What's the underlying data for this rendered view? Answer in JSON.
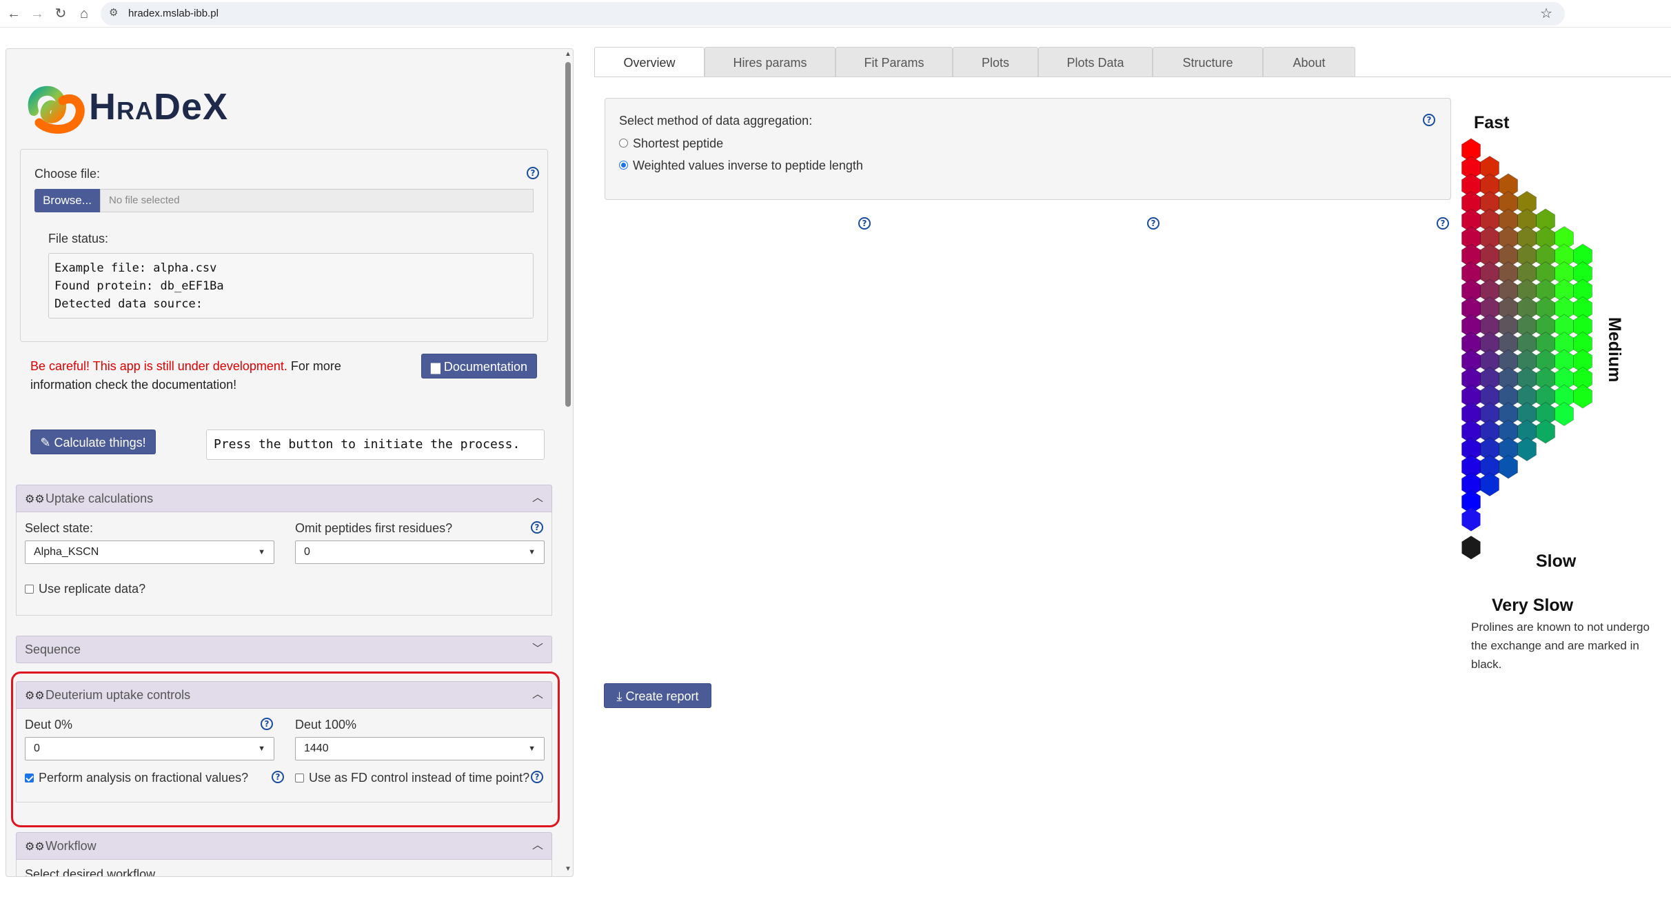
{
  "browser": {
    "url": "hradex.mslab-ibb.pl"
  },
  "logo": {
    "text": "HRaDeX"
  },
  "file": {
    "choose_label": "Choose file:",
    "browse_label": "Browse...",
    "placeholder": "No file selected",
    "status_label": "File status:",
    "status_lines": [
      "Example file: alpha.csv",
      "Found protein: db_eEF1Ba",
      "Detected data source:"
    ]
  },
  "warning": {
    "red": "Be careful! This app is still under development.",
    "rest": " For more information check the documentation!"
  },
  "documentation_button": "Documentation",
  "calculate_button": "Calculate things!",
  "process_text": "Press the button to initiate the process.",
  "uptake": {
    "title": "Uptake calculations",
    "state_label": "Select state:",
    "state_value": "Alpha_KSCN",
    "omit_label": "Omit peptides first residues?",
    "omit_value": "0",
    "replicate_label": "Use replicate data?",
    "replicate_checked": false
  },
  "sequence": {
    "title": "Sequence"
  },
  "deut": {
    "title": "Deuterium uptake controls",
    "deut0_label": "Deut 0%",
    "deut0_value": "0",
    "deut100_label": "Deut 100%",
    "deut100_value": "1440",
    "fractional_label": "Perform analysis on fractional values?",
    "fractional_checked": true,
    "fd_label": "Use as FD control instead of time point?",
    "fd_checked": false
  },
  "workflow": {
    "title": "Workflow",
    "partial_label": "Select desired workflow"
  },
  "tabs": [
    "Overview",
    "Hires params",
    "Fit Params",
    "Plots",
    "Plots Data",
    "Structure",
    "About"
  ],
  "active_tab": "Overview",
  "aggregation": {
    "title": "Select method of data aggregation:",
    "options": [
      "Shortest peptide",
      "Weighted values inverse to peptide length"
    ],
    "selected": "Weighted values inverse to peptide length"
  },
  "report_button": "Create report",
  "legend": {
    "fast": "Fast",
    "medium": "Medium",
    "slow": "Slow",
    "very_slow": "Very Slow",
    "note": "Prolines are known to not undergo the exchange and are marked in black.",
    "colors": {
      "fast": "#ff0000",
      "medium": "#00ff00",
      "slow": "#0000ff",
      "very_slow": "#1e1e1e"
    }
  },
  "colors": {
    "button": "#4a5b97",
    "accordion": "#e2dcea",
    "highlight": "#e0141e",
    "help": "#1a4c9f"
  }
}
